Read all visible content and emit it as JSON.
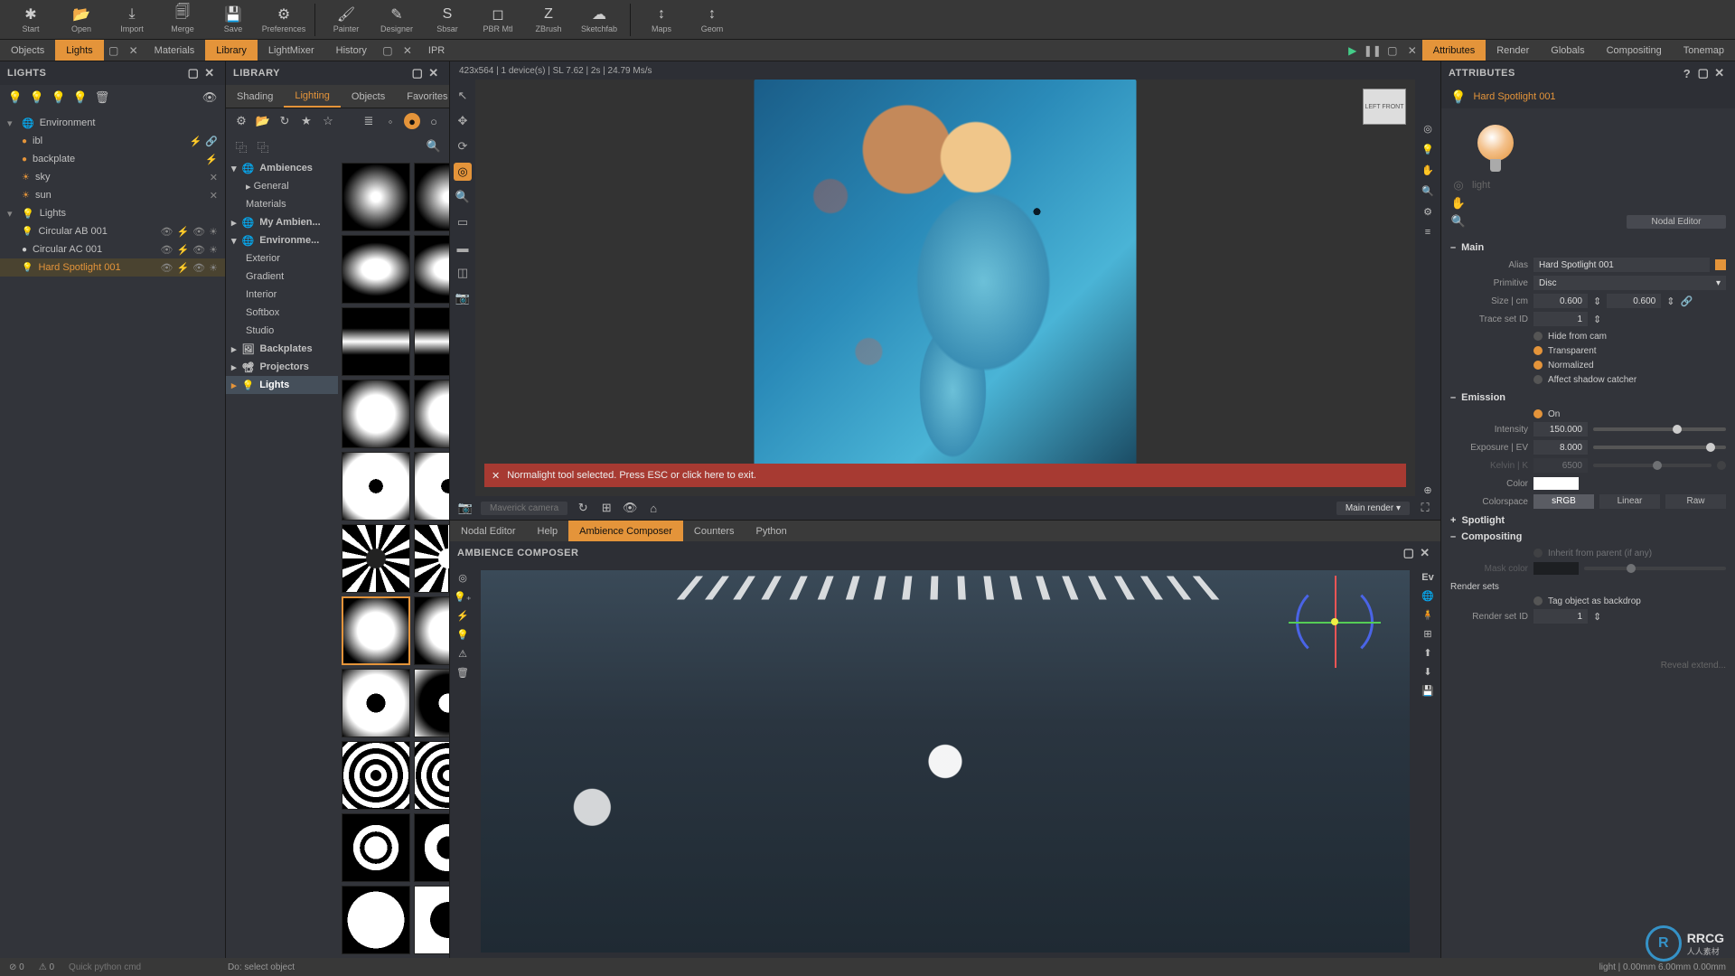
{
  "toolbar": {
    "groups": [
      [
        "Start",
        "Open",
        "Import",
        "Merge",
        "Save",
        "Preferences"
      ],
      [
        "Painter",
        "Designer",
        "Sbsar",
        "PBR Mtl",
        "ZBrush",
        "Sketchfab"
      ],
      [
        "Maps",
        "Geom"
      ]
    ],
    "icons": [
      [
        "✱",
        "📂",
        "⤓",
        "🗐",
        "💾",
        "⚙"
      ],
      [
        "🖌",
        "✎",
        "S",
        "◻",
        "Z",
        "☁"
      ],
      [
        "↕",
        "↕"
      ]
    ]
  },
  "left_tabs": {
    "items": [
      "Objects",
      "Lights"
    ],
    "active": 1
  },
  "lib_top_tabs": {
    "items": [
      "Materials",
      "Library",
      "LightMixer",
      "History"
    ],
    "active": 1
  },
  "ipr": {
    "title": "IPR"
  },
  "right_tabs": {
    "items": [
      "Attributes",
      "Render",
      "Globals",
      "Compositing",
      "Tonemap"
    ],
    "active": 0
  },
  "lights_panel": {
    "title": "LIGHTS",
    "env": {
      "label": "Environment",
      "items": [
        "ibl",
        "backplate",
        "sky",
        "sun"
      ]
    },
    "lights": {
      "label": "Lights",
      "items": [
        "Circular AB 001",
        "Circular AC 001",
        "Hard Spotlight 001"
      ],
      "selected": 2
    }
  },
  "library_panel": {
    "title": "LIBRARY",
    "subtabs": {
      "items": [
        "Shading",
        "Lighting",
        "Objects",
        "Favorites"
      ],
      "active": 1
    },
    "tree": {
      "ambiences": {
        "label": "Ambiences",
        "items": [
          "General",
          "Materials"
        ]
      },
      "myamb": {
        "label": "My Ambien..."
      },
      "environments": {
        "label": "Environme...",
        "items": [
          "Exterior",
          "Gradient",
          "Interior",
          "Softbox",
          "Studio"
        ]
      },
      "backplates": {
        "label": "Backplates"
      },
      "projectors": {
        "label": "Projectors"
      },
      "lights": {
        "label": "Lights",
        "selected": true
      }
    }
  },
  "ipr_stats": "423x564  |  1 device(s)  |  SL 7.62  |  2s  |  24.79 Ms/s",
  "orientation_cube": "LEFT  FRONT",
  "alert": "Normalight tool selected. Press ESC or click here to exit.",
  "cam_bar": {
    "camera": "Maverick camera",
    "render_mode": "Main render"
  },
  "lower_tabs": {
    "items": [
      "Nodal Editor",
      "Help",
      "Ambience Composer",
      "Counters",
      "Python"
    ],
    "active": 2
  },
  "ambience_panel": {
    "title": "AMBIENCE COMPOSER",
    "right_label": "Ev"
  },
  "attributes": {
    "title": "ATTRIBUTES",
    "object": "Hard Spotlight 001",
    "type_label": "light",
    "nodal_btn": "Nodal Editor",
    "main": {
      "label": "Main",
      "alias_label": "Alias",
      "alias": "Hard Spotlight 001",
      "primitive_label": "Primitive",
      "primitive": "Disc",
      "size_label": "Size | cm",
      "size_a": "0.600",
      "size_b": "0.600",
      "traceset_label": "Trace set ID",
      "traceset": "1",
      "hide_from_cam": "Hide from cam",
      "transparent": "Transparent",
      "normalized": "Normalized",
      "affect_shadow": "Affect shadow catcher"
    },
    "emission": {
      "label": "Emission",
      "on_label": "On",
      "intensity_label": "Intensity",
      "intensity": "150.000",
      "exposure_label": "Exposure | EV",
      "exposure": "8.000",
      "kelvin_label": "Kelvin | K",
      "kelvin": "6500",
      "color_label": "Color",
      "colorspace_label": "Colorspace",
      "colorspace_opts": [
        "sRGB",
        "Linear",
        "Raw"
      ],
      "colorspace_active": 0
    },
    "spotlight": {
      "label": "Spotlight"
    },
    "compositing": {
      "label": "Compositing",
      "inherit": "Inherit from parent (if any)",
      "mask_color": "Mask color",
      "render_sets": "Render sets",
      "tag_backdrop": "Tag object as backdrop",
      "render_set_id_label": "Render set ID",
      "render_set_id": "1",
      "reveal": "Reveal extend..."
    }
  },
  "statusbar": {
    "counters": {
      "err": "0",
      "warn": "0"
    },
    "cmd_placeholder": "Quick python cmd",
    "hint": "Do: select object",
    "right": "light  |  0.00mm 6.00mm 0.00mm"
  },
  "watermark": {
    "main": "RRCG",
    "sub": "人人素材"
  }
}
